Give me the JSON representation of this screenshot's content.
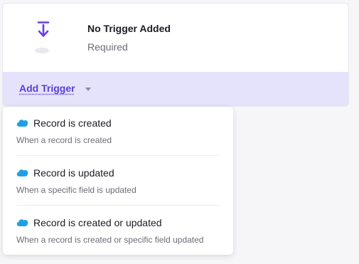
{
  "trigger_card": {
    "title": "No Trigger Added",
    "subtitle": "Required",
    "add_trigger_label": "Add Trigger"
  },
  "menu": {
    "items": [
      {
        "icon": "salesforce-cloud-icon",
        "label": "Record is created",
        "description": "When a record is created"
      },
      {
        "icon": "salesforce-cloud-icon",
        "label": "Record is updated",
        "description": "When a specific field is updated"
      },
      {
        "icon": "salesforce-cloud-icon",
        "label": "Record is created or updated",
        "description": "When a record is created or specific field updated"
      }
    ]
  },
  "colors": {
    "accent": "#5a3ed8",
    "footer_bg": "#e5e2fb",
    "salesforce_blue": "#1ea0e6"
  }
}
